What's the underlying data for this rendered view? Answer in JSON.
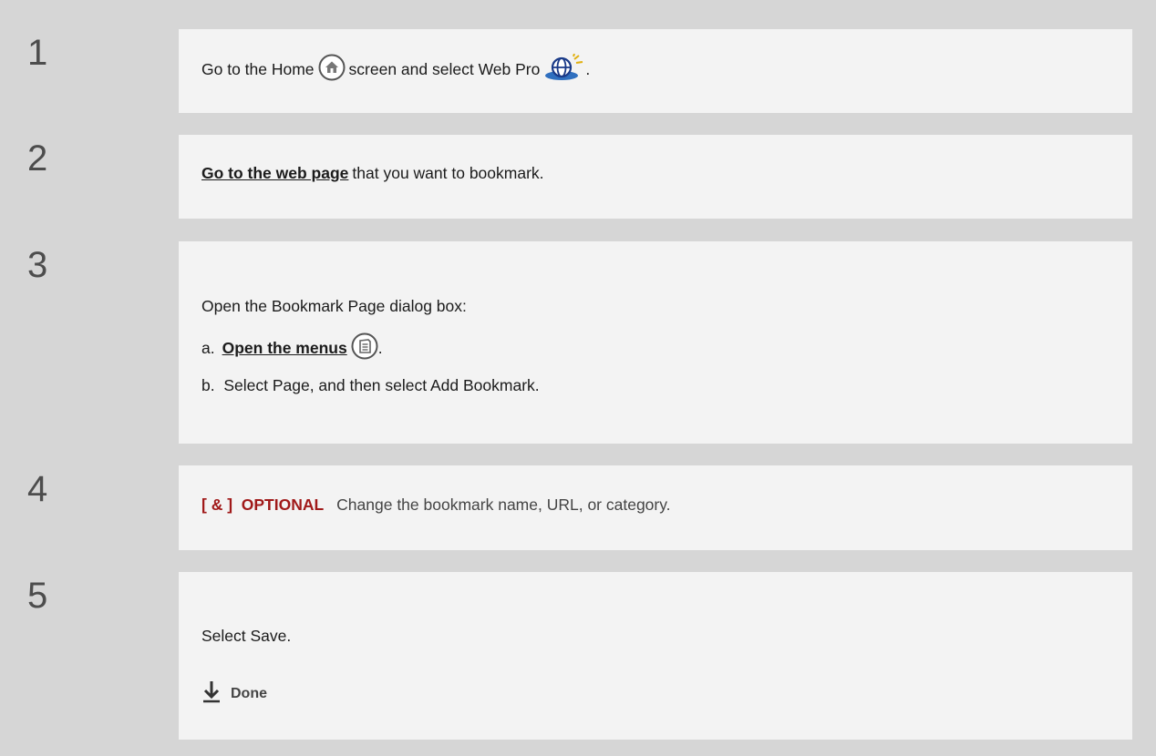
{
  "steps": [
    {
      "number": "1",
      "text_a": "Go to the Home",
      "text_b": "screen and select Web Pro",
      "text_c": ".",
      "icons": [
        "home-icon",
        "web-pro-globe-icon"
      ]
    },
    {
      "number": "2",
      "link": "Go to the web page",
      "text": "that you want to bookmark."
    },
    {
      "number": "3",
      "intro": "Open the Bookmark Page dialog box:",
      "a_prefix": "a.",
      "a_link": "Open the menus",
      "a_suffix": ".",
      "a_icon": "menu-icon",
      "b_text": "b.  Select Page, and then select Add Bookmark."
    },
    {
      "number": "4",
      "tag": "[ & ]  OPTIONAL",
      "text": "Change the bookmark name, URL, or category."
    },
    {
      "number": "5",
      "text": "Select Save.",
      "done_label": "Done",
      "done_icon": "down-arrow-icon"
    }
  ],
  "colors": {
    "background": "#d6d6d6",
    "panel": "#f3f3f3",
    "optional": "#a01919"
  }
}
